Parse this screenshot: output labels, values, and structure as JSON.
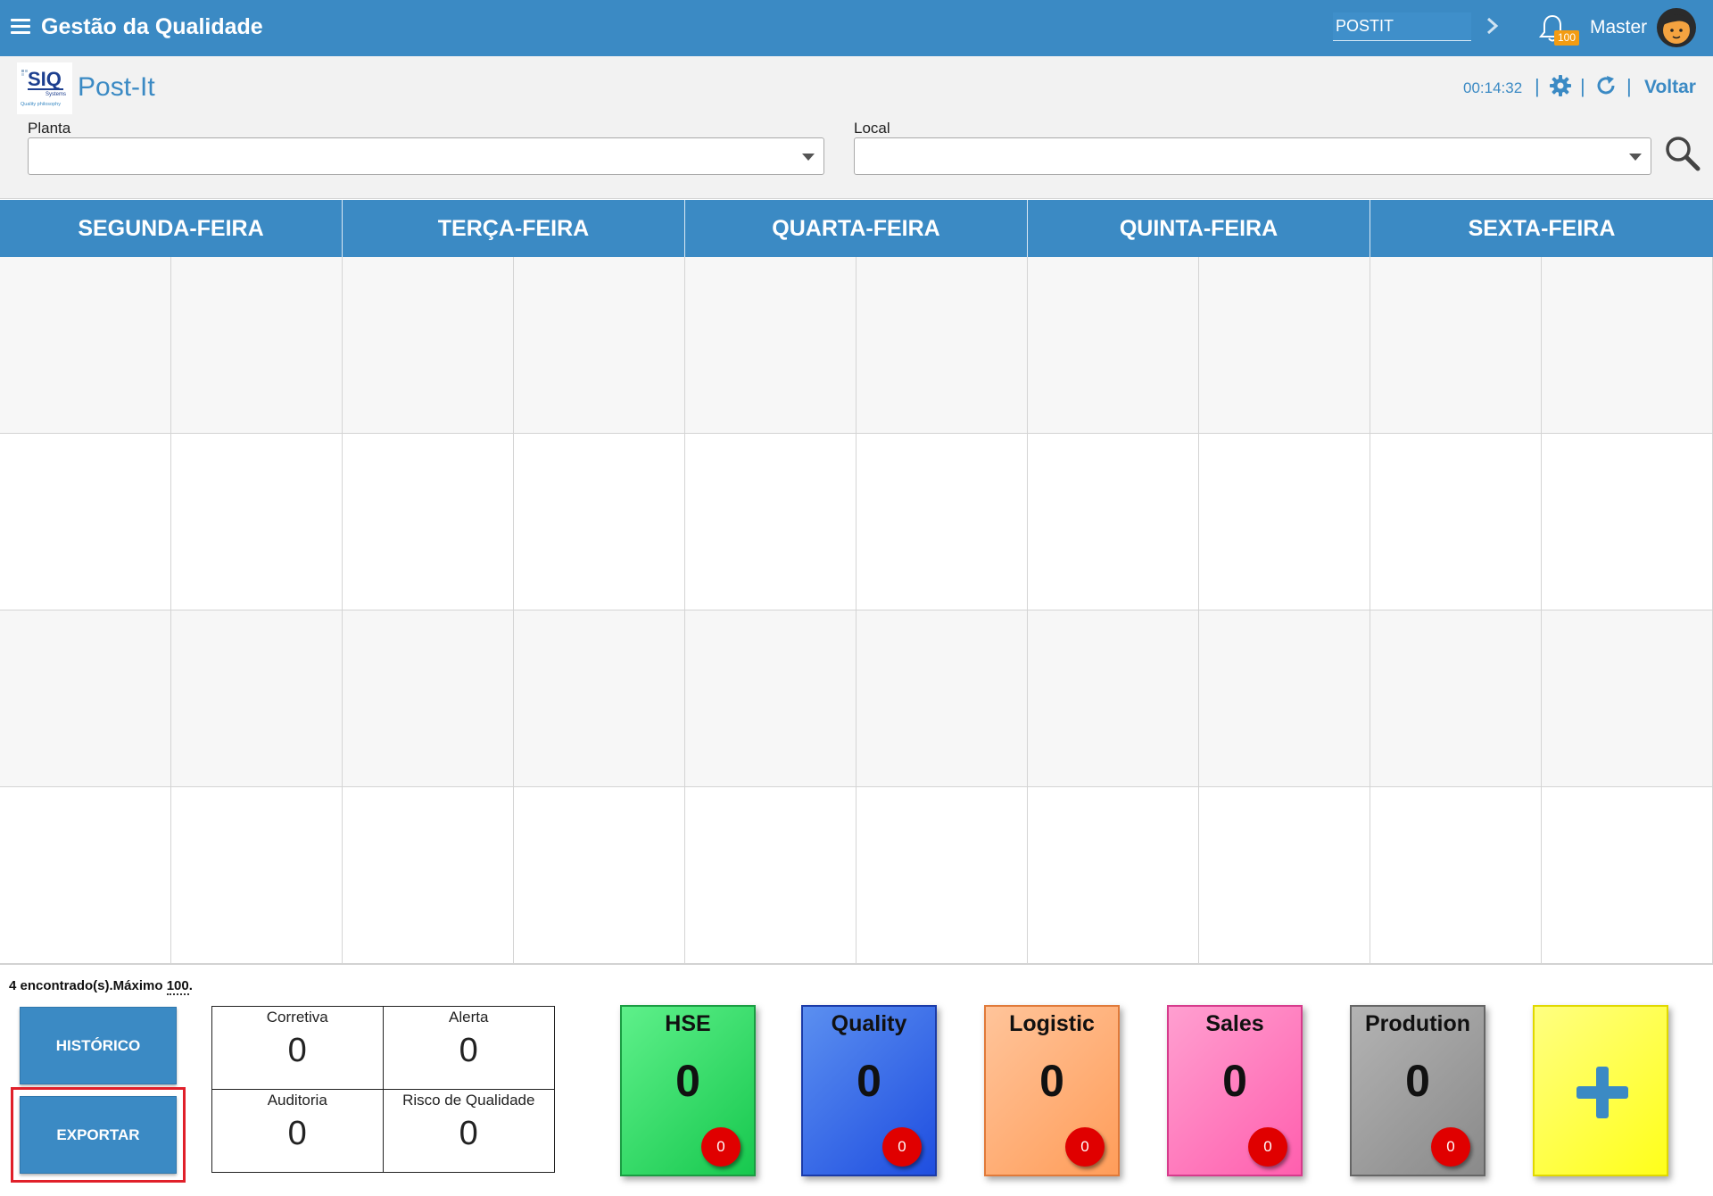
{
  "topbar": {
    "title": "Gestão da Qualidade",
    "module_input_value": "POSTIT",
    "notification_count": "100",
    "user_name": "Master"
  },
  "header": {
    "page_title": "Post-It",
    "timer": "00:14:32",
    "back_label": "Voltar",
    "separator": "|"
  },
  "filters": {
    "plant_label": "Planta",
    "plant_value": "",
    "local_label": "Local",
    "local_value": ""
  },
  "board": {
    "days": [
      "SEGUNDA-FEIRA",
      "TERÇA-FEIRA",
      "QUARTA-FEIRA",
      "QUINTA-FEIRA",
      "SEXTA-FEIRA"
    ]
  },
  "footer": {
    "found_text": "4 encontrado(s).Máximo ",
    "max_value": "100",
    "found_suffix": ".",
    "history_button": "HISTÓRICO",
    "export_button": "EXPORTAR",
    "stats": [
      {
        "label": "Corretiva",
        "value": "0"
      },
      {
        "label": "Alerta",
        "value": "0"
      },
      {
        "label": "Auditoria",
        "value": "0"
      },
      {
        "label": "Risco de Qualidade",
        "value": "0"
      }
    ],
    "categories": [
      {
        "name": "HSE",
        "count": "0",
        "badge": "0",
        "color_top": "#5ef08a",
        "color_bottom": "#17c84e",
        "border": "#1a9c42"
      },
      {
        "name": "Quality",
        "count": "0",
        "badge": "0",
        "color_top": "#5b8ff0",
        "color_bottom": "#1f4ee0",
        "border": "#1a3aa8"
      },
      {
        "name": "Logistic",
        "count": "0",
        "badge": "0",
        "color_top": "#ffc49a",
        "color_bottom": "#ff9d5a",
        "border": "#e07a3a"
      },
      {
        "name": "Sales",
        "count": "0",
        "badge": "0",
        "color_top": "#ff9fd0",
        "color_bottom": "#ff5fae",
        "border": "#d63b8c"
      },
      {
        "name": "Prodution",
        "count": "0",
        "badge": "0",
        "color_top": "#b3b3b3",
        "color_bottom": "#8a8a8a",
        "border": "#666666"
      }
    ],
    "add_card": {
      "color_top": "#ffff80",
      "color_bottom": "#ffff1a",
      "border": "#e0d800",
      "plus_color": "#3b8ac4"
    }
  },
  "icons": {
    "menu": "hamburger-icon",
    "go": "chevron-right-icon",
    "notifications": "bell-icon",
    "settings": "gear-icon",
    "refresh": "refresh-icon",
    "search": "search-icon",
    "add": "plus-icon"
  }
}
